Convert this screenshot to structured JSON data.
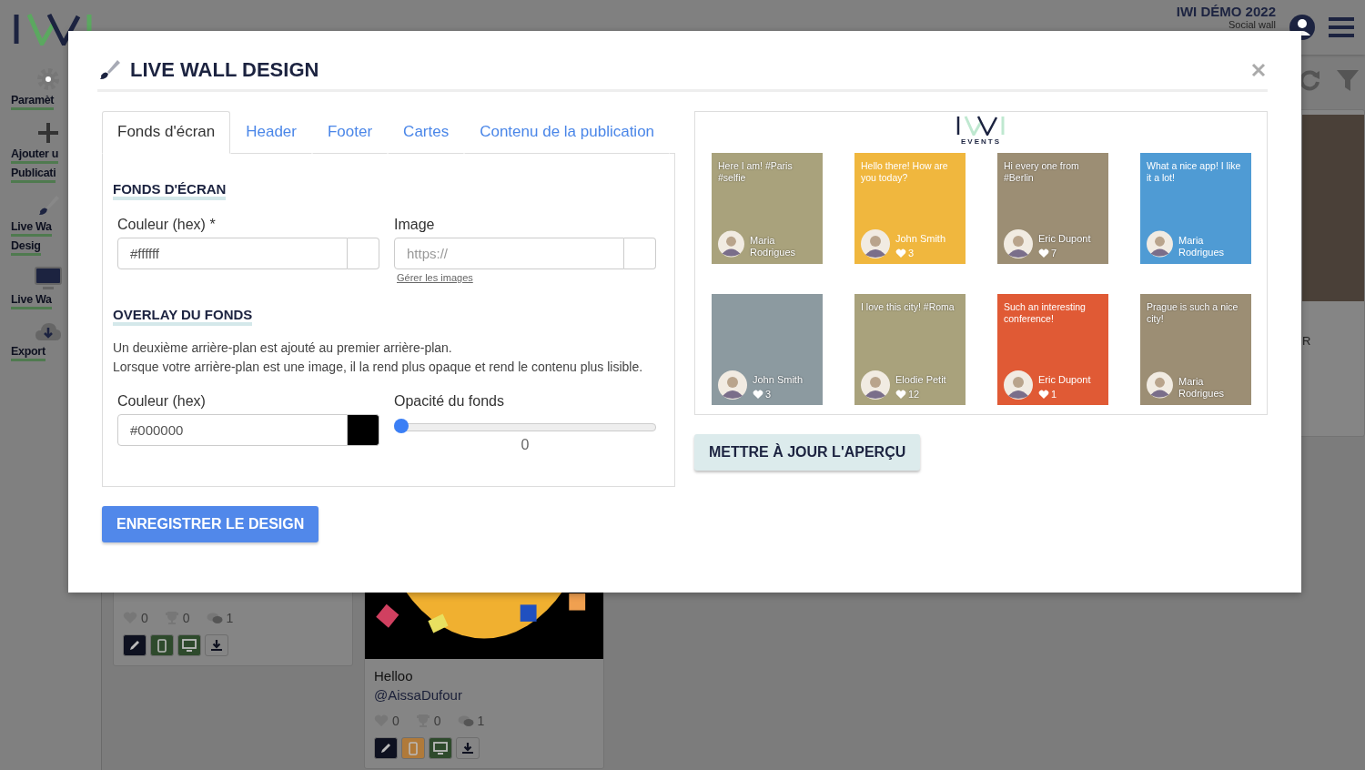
{
  "app_header": {
    "brand_title": "IWI DÉMO 2022",
    "brand_subtitle": "Social wall"
  },
  "sidebar": {
    "items": [
      {
        "kind": "gear",
        "label_lines": [
          "Paramèt"
        ]
      },
      {
        "kind": "plus",
        "label_lines": [
          "Ajouter u",
          "Publicati"
        ]
      },
      {
        "kind": "brush",
        "label_lines": [
          "Live Wa",
          "Desig"
        ]
      },
      {
        "kind": "monitor",
        "label_lines": [
          "Live Wa"
        ]
      },
      {
        "kind": "cloud",
        "label_lines": [
          "Export"
        ]
      }
    ]
  },
  "posts": [
    {
      "kind": "text",
      "stats": [
        {
          "kind": "likes",
          "count": "0"
        },
        {
          "kind": "trophies",
          "count": "0"
        },
        {
          "kind": "comments",
          "count": "1"
        }
      ],
      "buttons": [
        {
          "kind": "edit",
          "color": "#0e1120"
        },
        {
          "kind": "mobile",
          "color": "#2e4a2c"
        },
        {
          "kind": "monitor",
          "color": "#2e4a2c"
        },
        {
          "kind": "download",
          "color": "#858585"
        }
      ]
    },
    {
      "kind": "image",
      "text": "Helloo",
      "author": "@AissaDufour",
      "stats": [
        {
          "kind": "likes",
          "count": "0"
        },
        {
          "kind": "trophies",
          "count": "0"
        },
        {
          "kind": "comments",
          "count": "1"
        }
      ],
      "buttons": [
        {
          "kind": "edit",
          "color": "#0e1120"
        },
        {
          "kind": "mobile",
          "color": "#b07a3a"
        },
        {
          "kind": "monitor",
          "color": "#2e4a2c"
        },
        {
          "kind": "download",
          "color": "#858585"
        }
      ]
    },
    {
      "kind": "photo",
      "text": "R"
    }
  ],
  "modal": {
    "title": "LIVE WALL DESIGN",
    "tabs": [
      {
        "label": "Fonds d'écran",
        "selected": true
      },
      {
        "label": "Header",
        "selected": false
      },
      {
        "label": "Footer",
        "selected": false
      },
      {
        "label": "Cartes",
        "selected": false
      },
      {
        "label": "Contenu de la publication",
        "selected": false
      }
    ],
    "background_section": {
      "heading": "FONDS D'ÉCRAN",
      "color_field": {
        "label": "Couleur (hex) *",
        "value": "#ffffff"
      },
      "image_field": {
        "label": "Image",
        "placeholder": "https://"
      },
      "manage_link": "Gérer les images"
    },
    "overlay_section": {
      "heading": "OVERLAY DU FONDS",
      "description": [
        "Un deuxième arrière-plan est ajouté au premier arrière-plan.",
        "Lorsque votre arrière-plan est une image, il la rend plus opaque et rend le contenu plus lisible."
      ],
      "color_field": {
        "label": "Couleur (hex)",
        "value": "#000000"
      },
      "opacity": {
        "label": "Opacité du fonds",
        "level": 0,
        "reading": "0"
      }
    },
    "save_button": "ENREGISTRER LE DESIGN",
    "preview": {
      "logo_caption": "EVENTS",
      "cards": [
        {
          "kind": "photo",
          "text": "Here I am! #Paris #selfie",
          "author": "Maria Rodrigues"
        },
        {
          "kind": "color",
          "color": "#f0b73e",
          "text": "Hello there! How are you today?",
          "author": "John Smith",
          "likes": "3"
        },
        {
          "kind": "photo",
          "text": "Hi every one from #Berlin",
          "author": "Eric Dupont",
          "likes": "7"
        },
        {
          "kind": "color",
          "color": "#4f9bd4",
          "text": "What a nice app! I like it a lot!",
          "author": "Maria Rodrigues"
        },
        {
          "kind": "photo",
          "author": "John Smith",
          "likes": "3"
        },
        {
          "kind": "photo",
          "text": "I love this city! #Roma",
          "author": "Elodie Petit",
          "likes": "12"
        },
        {
          "kind": "color",
          "color": "#e05a35",
          "text": "Such an interesting conference!",
          "author": "Eric Dupont",
          "likes": "1"
        },
        {
          "kind": "photo",
          "text": "Prague is such a nice city!",
          "author": "Maria Rodrigues"
        }
      ]
    },
    "update_button": "METTRE À JOUR L'APERÇU"
  }
}
